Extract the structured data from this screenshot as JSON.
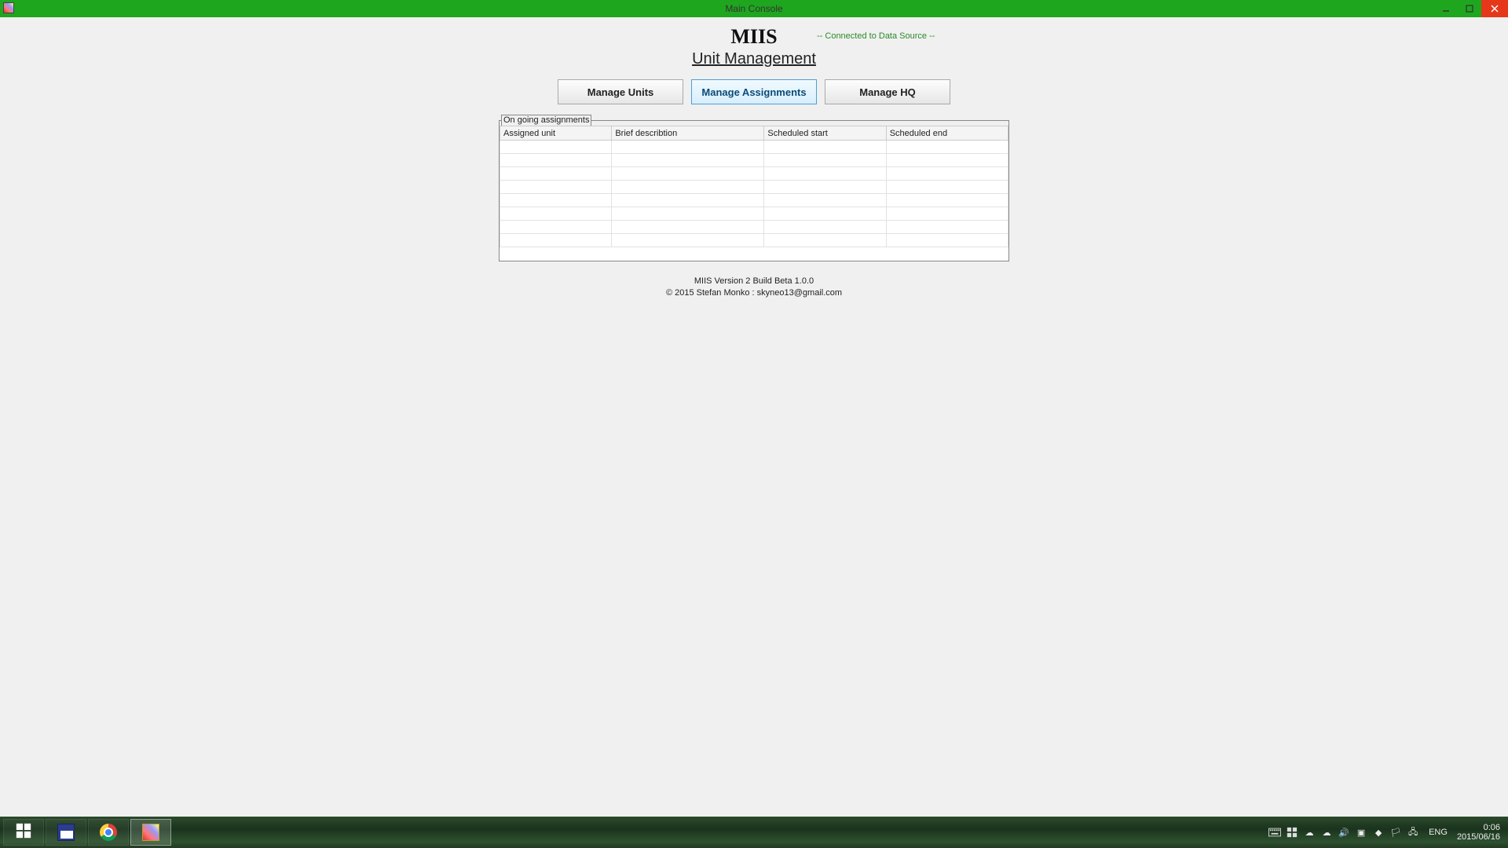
{
  "window": {
    "title": "Main Console"
  },
  "header": {
    "app_title": "MIIS",
    "subtitle": "Unit Management",
    "connection_status": "-- Connected to Data Source --"
  },
  "tabs": {
    "manage_units": "Manage Units",
    "manage_assignments": "Manage Assignments",
    "manage_hq": "Manage HQ"
  },
  "group": {
    "label": "On going assignments",
    "columns": {
      "assigned_unit": "Assigned unit",
      "brief_description": "Brief describtion",
      "scheduled_start": "Scheduled start",
      "scheduled_end": "Scheduled end"
    }
  },
  "footer": {
    "line1": "MIIS Version 2 Build Beta 1.0.0",
    "line2": "© 2015 Stefan Monko : skyneo13@gmail.com"
  },
  "taskbar": {
    "lang": "ENG",
    "time": "0:06",
    "date": "2015/06/16"
  }
}
